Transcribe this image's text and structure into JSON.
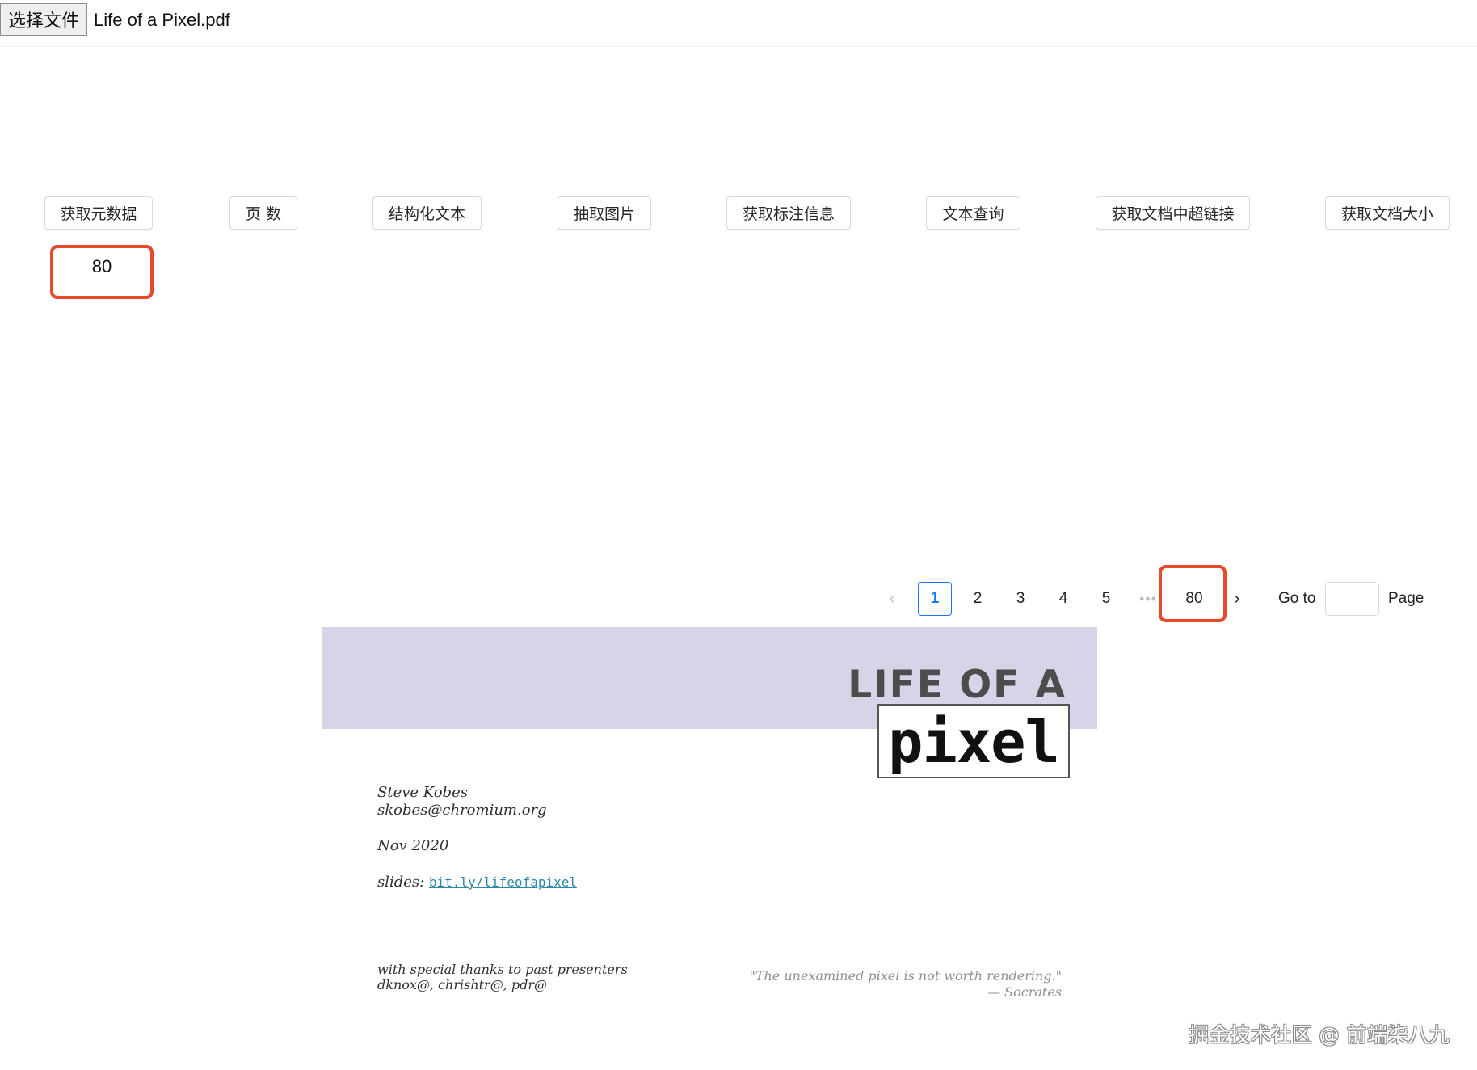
{
  "file_input": {
    "button_label": "选择文件",
    "file_name": "Life of a Pixel.pdf"
  },
  "actions": [
    {
      "label": "获取元数据"
    },
    {
      "label": "页 数"
    },
    {
      "label": "结构化文本"
    },
    {
      "label": "抽取图片"
    },
    {
      "label": "获取标注信息"
    },
    {
      "label": "文本查询"
    },
    {
      "label": "获取文档中超链接"
    },
    {
      "label": "获取文档大小"
    }
  ],
  "result": {
    "value": "80"
  },
  "pagination": {
    "prev_icon": "chevron-left-icon",
    "next_icon": "chevron-right-icon",
    "pages": [
      "1",
      "2",
      "3",
      "4",
      "5"
    ],
    "ellipsis": "•••",
    "last_page": "80",
    "current_page": "1",
    "goto_label": "Go to",
    "goto_value": "",
    "page_label": "Page"
  },
  "pdf_preview": {
    "banner_color": "#d8d4e7",
    "title_top": "LIFE OF A",
    "title_bottom": "pixel",
    "author_name": "Steve Kobes",
    "author_email": "skobes@chromium.org",
    "date": "Nov 2020",
    "slides_label": "slides:",
    "slides_link": "bit.ly/lifeofapixel",
    "thanks_line1": "with special thanks to past presenters",
    "thanks_line2": "dknox@, chrishtr@, pdr@",
    "quote": "\"The unexamined pixel is not worth rendering.\"",
    "quote_author": "— Socrates"
  },
  "watermark": "掘金技术社区 @ 前端柒八九",
  "colors": {
    "highlight_red": "#e64a2e",
    "active_blue": "#1677ff"
  }
}
